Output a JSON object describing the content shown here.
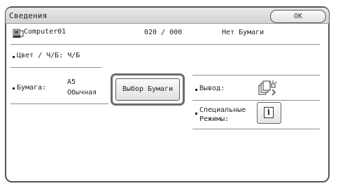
{
  "window": {
    "title": "Сведения",
    "ok_label": "OK"
  },
  "job": {
    "name": "Computer01",
    "counter": "020 / 000",
    "status": "Нет Бумаги"
  },
  "color_mode": {
    "label": "Цвет / Ч/Б: Ч/Б"
  },
  "paper": {
    "label": "Бумага:",
    "size": "A5",
    "type": "Обычная",
    "select_button_label": "Выбор Бумаги"
  },
  "output": {
    "label": "Вывод:"
  },
  "special_modes": {
    "label_line1": "Специальные",
    "label_line2": "Режимы:"
  },
  "icons": {
    "job": "computer-icon",
    "output": "output-tray-icon",
    "special_modes": "info-icon"
  },
  "colors": {
    "title_bar": "#dcdcdc",
    "border": "#555555",
    "highlight_frame": "#6b6b6b"
  }
}
